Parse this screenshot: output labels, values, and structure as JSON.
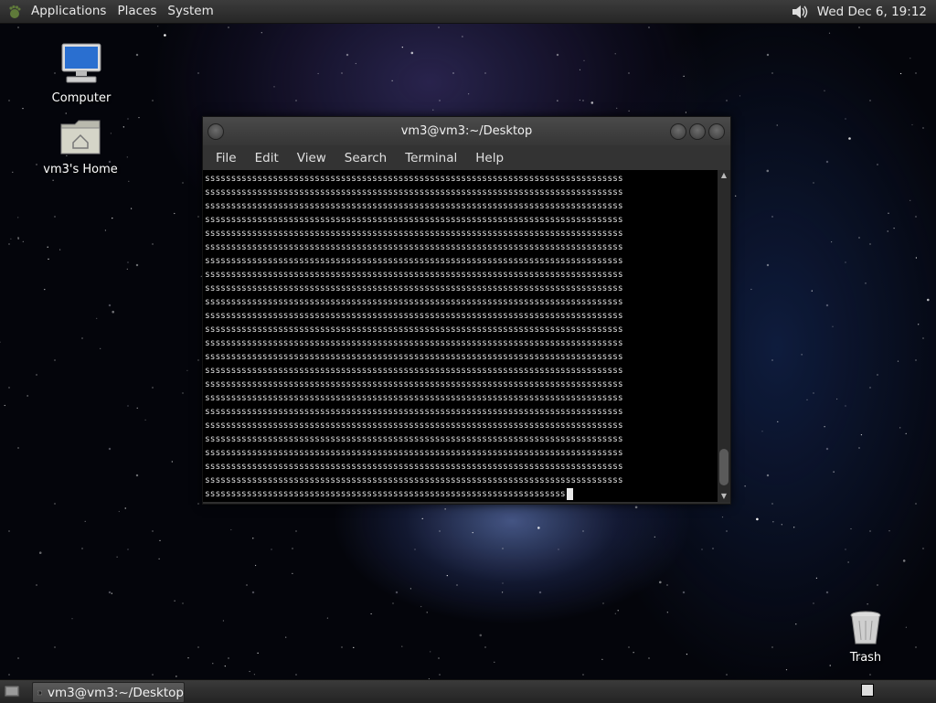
{
  "top_panel": {
    "menus": [
      "Applications",
      "Places",
      "System"
    ],
    "clock": "Wed Dec  6, 19:12",
    "icons": {
      "logo": "gnome-foot-icon",
      "volume": "speaker-icon"
    }
  },
  "desktop": {
    "computer_label": "Computer",
    "home_label": "vm3's Home",
    "trash_label": "Trash"
  },
  "terminal": {
    "title": "vm3@vm3:~/Desktop",
    "menu": [
      "File",
      "Edit",
      "View",
      "Search",
      "Terminal",
      "Help"
    ],
    "content": {
      "repeated_char": "s",
      "full_rows": 23,
      "chars_per_row": 80,
      "last_row_chars": 69
    }
  },
  "taskbar": {
    "task_label": "vm3@vm3:~/Desktop"
  }
}
